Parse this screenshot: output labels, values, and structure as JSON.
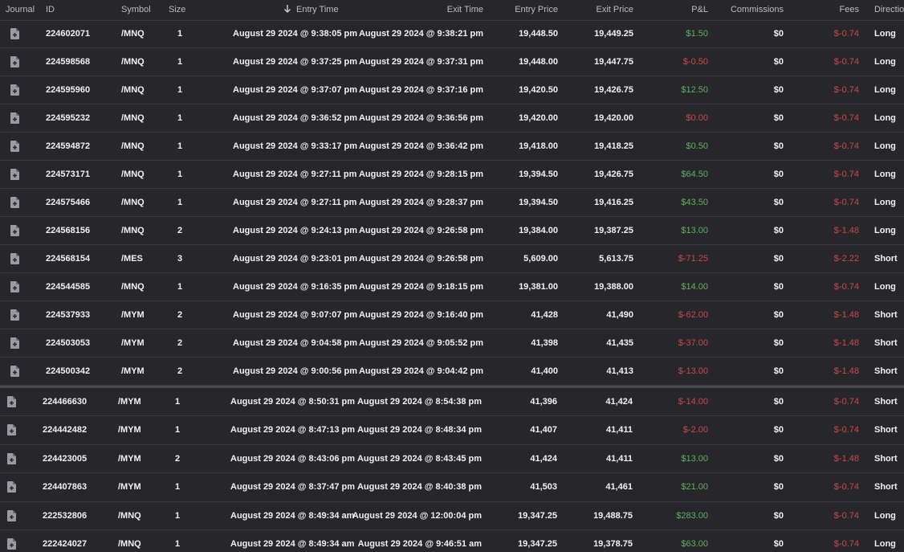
{
  "header": {
    "journal": "Journal",
    "id": "ID",
    "symbol": "Symbol",
    "size": "Size",
    "entry_time": "Entry Time",
    "exit_time": "Exit Time",
    "entry_price": "Entry Price",
    "exit_price": "Exit Price",
    "pnl": "P&L",
    "commissions": "Commissions",
    "fees": "Fees",
    "direction": "Direction"
  },
  "colors": {
    "positive": "#5fb15f",
    "negative": "#c94a4a",
    "background": "#27272b"
  },
  "icons": {
    "journal": "add-note-icon",
    "sort": "arrow-down-icon"
  },
  "trades_group_a": [
    {
      "id": "224602071",
      "symbol": "/MNQ",
      "size": "1",
      "entry_time": "August 29 2024 @ 9:38:05 pm",
      "exit_time": "August 29 2024 @ 9:38:21 pm",
      "entry_price": "19,448.50",
      "exit_price": "19,449.25",
      "pnl": "$1.50",
      "pnl_sign": "pos",
      "commissions": "$0",
      "fees": "$-0.74",
      "direction": "Long"
    },
    {
      "id": "224598568",
      "symbol": "/MNQ",
      "size": "1",
      "entry_time": "August 29 2024 @ 9:37:25 pm",
      "exit_time": "August 29 2024 @ 9:37:31 pm",
      "entry_price": "19,448.00",
      "exit_price": "19,447.75",
      "pnl": "$-0.50",
      "pnl_sign": "neg",
      "commissions": "$0",
      "fees": "$-0.74",
      "direction": "Long"
    },
    {
      "id": "224595960",
      "symbol": "/MNQ",
      "size": "1",
      "entry_time": "August 29 2024 @ 9:37:07 pm",
      "exit_time": "August 29 2024 @ 9:37:16 pm",
      "entry_price": "19,420.50",
      "exit_price": "19,426.75",
      "pnl": "$12.50",
      "pnl_sign": "pos",
      "commissions": "$0",
      "fees": "$-0.74",
      "direction": "Long"
    },
    {
      "id": "224595232",
      "symbol": "/MNQ",
      "size": "1",
      "entry_time": "August 29 2024 @ 9:36:52 pm",
      "exit_time": "August 29 2024 @ 9:36:56 pm",
      "entry_price": "19,420.00",
      "exit_price": "19,420.00",
      "pnl": "$0.00",
      "pnl_sign": "neg",
      "commissions": "$0",
      "fees": "$-0.74",
      "direction": "Long"
    },
    {
      "id": "224594872",
      "symbol": "/MNQ",
      "size": "1",
      "entry_time": "August 29 2024 @ 9:33:17 pm",
      "exit_time": "August 29 2024 @ 9:36:42 pm",
      "entry_price": "19,418.00",
      "exit_price": "19,418.25",
      "pnl": "$0.50",
      "pnl_sign": "pos",
      "commissions": "$0",
      "fees": "$-0.74",
      "direction": "Long"
    },
    {
      "id": "224573171",
      "symbol": "/MNQ",
      "size": "1",
      "entry_time": "August 29 2024 @ 9:27:11 pm",
      "exit_time": "August 29 2024 @ 9:28:15 pm",
      "entry_price": "19,394.50",
      "exit_price": "19,426.75",
      "pnl": "$64.50",
      "pnl_sign": "pos",
      "commissions": "$0",
      "fees": "$-0.74",
      "direction": "Long"
    },
    {
      "id": "224575466",
      "symbol": "/MNQ",
      "size": "1",
      "entry_time": "August 29 2024 @ 9:27:11 pm",
      "exit_time": "August 29 2024 @ 9:28:37 pm",
      "entry_price": "19,394.50",
      "exit_price": "19,416.25",
      "pnl": "$43.50",
      "pnl_sign": "pos",
      "commissions": "$0",
      "fees": "$-0.74",
      "direction": "Long"
    },
    {
      "id": "224568156",
      "symbol": "/MNQ",
      "size": "2",
      "entry_time": "August 29 2024 @ 9:24:13 pm",
      "exit_time": "August 29 2024 @ 9:26:58 pm",
      "entry_price": "19,384.00",
      "exit_price": "19,387.25",
      "pnl": "$13.00",
      "pnl_sign": "pos",
      "commissions": "$0",
      "fees": "$-1.48",
      "direction": "Long"
    },
    {
      "id": "224568154",
      "symbol": "/MES",
      "size": "3",
      "entry_time": "August 29 2024 @ 9:23:01 pm",
      "exit_time": "August 29 2024 @ 9:26:58 pm",
      "entry_price": "5,609.00",
      "exit_price": "5,613.75",
      "pnl": "$-71.25",
      "pnl_sign": "neg",
      "commissions": "$0",
      "fees": "$-2.22",
      "direction": "Short"
    },
    {
      "id": "224544585",
      "symbol": "/MNQ",
      "size": "1",
      "entry_time": "August 29 2024 @ 9:16:35 pm",
      "exit_time": "August 29 2024 @ 9:18:15 pm",
      "entry_price": "19,381.00",
      "exit_price": "19,388.00",
      "pnl": "$14.00",
      "pnl_sign": "pos",
      "commissions": "$0",
      "fees": "$-0.74",
      "direction": "Long"
    },
    {
      "id": "224537933",
      "symbol": "/MYM",
      "size": "2",
      "entry_time": "August 29 2024 @ 9:07:07 pm",
      "exit_time": "August 29 2024 @ 9:16:40 pm",
      "entry_price": "41,428",
      "exit_price": "41,490",
      "pnl": "$-62.00",
      "pnl_sign": "neg",
      "commissions": "$0",
      "fees": "$-1.48",
      "direction": "Short"
    },
    {
      "id": "224503053",
      "symbol": "/MYM",
      "size": "2",
      "entry_time": "August 29 2024 @ 9:04:58 pm",
      "exit_time": "August 29 2024 @ 9:05:52 pm",
      "entry_price": "41,398",
      "exit_price": "41,435",
      "pnl": "$-37.00",
      "pnl_sign": "neg",
      "commissions": "$0",
      "fees": "$-1.48",
      "direction": "Short"
    },
    {
      "id": "224500342",
      "symbol": "/MYM",
      "size": "2",
      "entry_time": "August 29 2024 @ 9:00:56 pm",
      "exit_time": "August 29 2024 @ 9:04:42 pm",
      "entry_price": "41,400",
      "exit_price": "41,413",
      "pnl": "$-13.00",
      "pnl_sign": "neg",
      "commissions": "$0",
      "fees": "$-1.48",
      "direction": "Short"
    }
  ],
  "trades_group_b": [
    {
      "id": "224466630",
      "symbol": "/MYM",
      "size": "1",
      "entry_time": "August 29 2024 @ 8:50:31 pm",
      "exit_time": "August 29 2024 @ 8:54:38 pm",
      "entry_price": "41,396",
      "exit_price": "41,424",
      "pnl": "$-14.00",
      "pnl_sign": "neg",
      "commissions": "$0",
      "fees": "$-0.74",
      "direction": "Short"
    },
    {
      "id": "224442482",
      "symbol": "/MYM",
      "size": "1",
      "entry_time": "August 29 2024 @ 8:47:13 pm",
      "exit_time": "August 29 2024 @ 8:48:34 pm",
      "entry_price": "41,407",
      "exit_price": "41,411",
      "pnl": "$-2.00",
      "pnl_sign": "neg",
      "commissions": "$0",
      "fees": "$-0.74",
      "direction": "Short"
    },
    {
      "id": "224423005",
      "symbol": "/MYM",
      "size": "2",
      "entry_time": "August 29 2024 @ 8:43:06 pm",
      "exit_time": "August 29 2024 @ 8:43:45 pm",
      "entry_price": "41,424",
      "exit_price": "41,411",
      "pnl": "$13.00",
      "pnl_sign": "pos",
      "commissions": "$0",
      "fees": "$-1.48",
      "direction": "Short"
    },
    {
      "id": "224407863",
      "symbol": "/MYM",
      "size": "1",
      "entry_time": "August 29 2024 @ 8:37:47 pm",
      "exit_time": "August 29 2024 @ 8:40:38 pm",
      "entry_price": "41,503",
      "exit_price": "41,461",
      "pnl": "$21.00",
      "pnl_sign": "pos",
      "commissions": "$0",
      "fees": "$-0.74",
      "direction": "Short"
    },
    {
      "id": "222532806",
      "symbol": "/MNQ",
      "size": "1",
      "entry_time": "August 29 2024 @ 8:49:34 am",
      "exit_time": "August 29 2024 @ 12:00:04 pm",
      "entry_price": "19,347.25",
      "exit_price": "19,488.75",
      "pnl": "$283.00",
      "pnl_sign": "pos",
      "commissions": "$0",
      "fees": "$-0.74",
      "direction": "Long"
    },
    {
      "id": "222424027",
      "symbol": "/MNQ",
      "size": "1",
      "entry_time": "August 29 2024 @ 8:49:34 am",
      "exit_time": "August 29 2024 @ 9:46:51 am",
      "entry_price": "19,347.25",
      "exit_price": "19,378.75",
      "pnl": "$63.00",
      "pnl_sign": "pos",
      "commissions": "$0",
      "fees": "$-0.74",
      "direction": "Long"
    }
  ]
}
